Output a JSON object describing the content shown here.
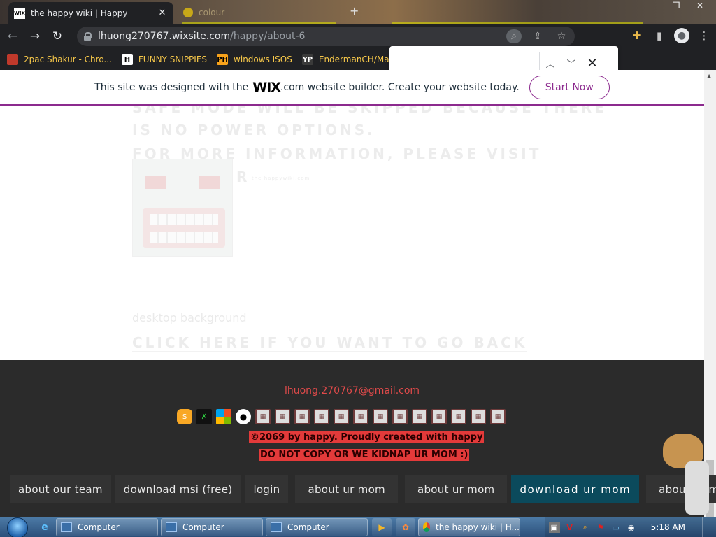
{
  "browser": {
    "active_tab": {
      "favicon_text": "WIX",
      "title": "the happy wiki | Happy"
    },
    "background_tab": {
      "title": "colour"
    },
    "new_tab_symbol": "+",
    "url": {
      "host": "lhuong270767.wixsite.com",
      "path": "/happy/about-6"
    },
    "bookmarks": [
      {
        "icon_text": "",
        "icon_color": "#e8eaed",
        "label": "2pac Shakur - Chro..."
      },
      {
        "icon_text": "H",
        "icon_color": "#ffffff",
        "label": "FUNNY SNIPPIES"
      },
      {
        "icon_text": "PH",
        "icon_color": "#f7a21b",
        "label": "windows ISOS"
      },
      {
        "icon_text": "YP",
        "icon_color": "#3a3a3a",
        "label": "EndermanCH/Malw..."
      }
    ],
    "find_bar": {
      "value": ""
    }
  },
  "wix_banner": {
    "text_before": "This site was designed with the",
    "logo": "WIX",
    "text_after": ".com website builder. Create your website today.",
    "button": "Start Now",
    "accent": "#8c2a8e"
  },
  "page": {
    "faded_line_1": "SAFE MODE WILL BE SKIPPED BECAUSE THERE",
    "faded_line_2": "IS NO POWER OPTIONS.",
    "faded_line_3": "FOR MORE INFORMATION, PLEASE VISIT",
    "faded_line_4": "OR",
    "faded_small": "  the happywiki.com",
    "desktop_background": "desktop background",
    "go_back": "CLICK HERE IF YOU WANT TO GO BACK"
  },
  "footer": {
    "email": "lhuong.270767@gmail.com",
    "social_icons": [
      "scratch-icon",
      "xbox-icon",
      "windows-icon",
      "github-icon",
      "face-icon",
      "face-icon",
      "face-icon",
      "face-icon",
      "face-icon",
      "face-icon",
      "face-icon",
      "face-icon",
      "face-icon",
      "face-icon",
      "face-icon",
      "face-icon",
      "face-icon"
    ],
    "copyright": "©2069 by happy. Proudly created with happy",
    "warning": "DO NOT COPY OR WE KIDNAP UR MOM :)",
    "nav": [
      {
        "label": "about our team",
        "highlight": false
      },
      {
        "label": "download msi (free)",
        "highlight": false
      },
      {
        "label": "login",
        "highlight": false
      },
      {
        "label": "about ur mom",
        "highlight": false
      },
      {
        "label": "about ur mom",
        "highlight": false
      },
      {
        "label": "download ur mom",
        "highlight": true
      },
      {
        "label": "about ur m",
        "highlight": false
      }
    ],
    "highlight_color": "#0b4a5c",
    "text_red": "#e33a3a"
  },
  "taskbar": {
    "items": [
      {
        "label": "Computer",
        "type": "explorer"
      },
      {
        "label": "Computer",
        "type": "explorer"
      },
      {
        "label": "Computer",
        "type": "explorer"
      },
      {
        "label": "the happy wiki | H...",
        "type": "chrome"
      }
    ],
    "clock": "5:18 AM"
  }
}
